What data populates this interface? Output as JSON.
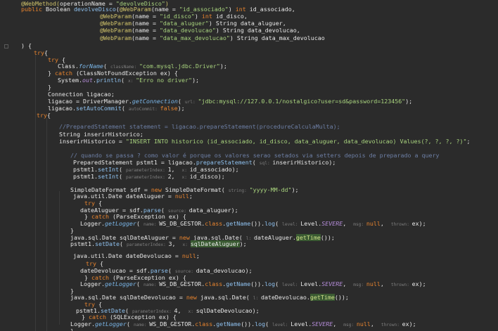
{
  "editor": {
    "lines": [
      {
        "tokens": [
          [
            "ann",
            "@WebMethod("
          ],
          [
            "pl",
            "operationName = "
          ],
          [
            "str",
            "\"devolveDisco\""
          ],
          [
            "ann",
            ")"
          ]
        ]
      },
      {
        "tokens": [
          [
            "kw",
            "public "
          ],
          [
            "pl",
            "Boolean "
          ],
          [
            "met",
            "devolveDisco"
          ],
          [
            "pl",
            "("
          ],
          [
            "ann",
            "@WebParam"
          ],
          [
            "pl",
            "(name = "
          ],
          [
            "str",
            "\"id_associado\""
          ],
          [
            "pl",
            ") "
          ],
          [
            "kw",
            "int "
          ],
          [
            "pl",
            "id_associado,"
          ]
        ]
      },
      {
        "tokens": [
          [
            "ann",
            "@WebParam"
          ],
          [
            "pl",
            "(name = "
          ],
          [
            "str",
            "\"id_disco\""
          ],
          [
            "pl",
            ") "
          ],
          [
            "kw",
            "int "
          ],
          [
            "pl",
            "id_disco,"
          ]
        ]
      },
      {
        "tokens": [
          [
            "ann",
            "@WebParam"
          ],
          [
            "pl",
            "(name = "
          ],
          [
            "str",
            "\"data_aluguer\""
          ],
          [
            "pl",
            ") String data_aluguer,"
          ]
        ]
      },
      {
        "tokens": [
          [
            "ann",
            "@WebParam"
          ],
          [
            "pl",
            "(name = "
          ],
          [
            "str",
            "\"data_devolucao\""
          ],
          [
            "pl",
            ") String data_devolucao,"
          ]
        ]
      },
      {
        "tokens": [
          [
            "ann",
            "@WebParam"
          ],
          [
            "pl",
            "(name = "
          ],
          [
            "str",
            "\"data_max_devolucao\""
          ],
          [
            "pl",
            ") String data_max_devolucao"
          ]
        ]
      },
      {
        "tokens": [
          [
            "pl",
            ") {"
          ]
        ]
      },
      {
        "tokens": [
          [
            "kw",
            "try"
          ],
          [
            "pl",
            "{"
          ]
        ]
      },
      {
        "tokens": [
          [
            "kw",
            "try "
          ],
          [
            "pl",
            "{"
          ]
        ]
      },
      {
        "tokens": [
          [
            "pl",
            "Class."
          ],
          [
            "it",
            "forName"
          ],
          [
            "pl",
            "( "
          ],
          [
            "hint",
            "className: "
          ],
          [
            "str",
            "\"com.mysql.jdbc.Driver\""
          ],
          [
            "pl",
            ");"
          ]
        ]
      },
      {
        "tokens": [
          [
            "pl",
            "} "
          ],
          [
            "kw",
            "catch "
          ],
          [
            "pl",
            "(ClassNotFoundException ex) {"
          ]
        ]
      },
      {
        "tokens": [
          [
            "pl",
            "System."
          ],
          [
            "con",
            "out"
          ],
          [
            "pl",
            "."
          ],
          [
            "met",
            "println"
          ],
          [
            "pl",
            "( "
          ],
          [
            "hint",
            "x: "
          ],
          [
            "str",
            "\"Erro no driver\""
          ],
          [
            "pl",
            ");"
          ]
        ]
      },
      {
        "tokens": [
          [
            "pl",
            "}"
          ]
        ]
      },
      {
        "tokens": [
          [
            "pl",
            "Connection ligacao;"
          ]
        ]
      },
      {
        "tokens": [
          [
            "pl",
            "ligacao = DriverManager."
          ],
          [
            "it",
            "getConnection"
          ],
          [
            "pl",
            "( "
          ],
          [
            "hint",
            "url: "
          ],
          [
            "str",
            "\"jdbc:mysql://127.0.0.1/nostalgico?user=sd&password=123456\""
          ],
          [
            "pl",
            ");"
          ]
        ]
      },
      {
        "tokens": [
          [
            "pl",
            "ligacao."
          ],
          [
            "met",
            "setAutoCommit"
          ],
          [
            "pl",
            "( "
          ],
          [
            "hint",
            "autoCommit: "
          ],
          [
            "kw",
            "false"
          ],
          [
            "pl",
            ");"
          ]
        ]
      },
      {
        "tokens": [
          [
            "kw",
            "try"
          ],
          [
            "pl",
            "{"
          ]
        ]
      },
      {
        "tokens": []
      },
      {
        "tokens": [
          [
            "cmt",
            "//PreparedStatement statement = ligacao.prepareStatement(procedureCalculaMulta);"
          ]
        ]
      },
      {
        "tokens": [
          [
            "pl",
            "String inserirHistorico;"
          ]
        ]
      },
      {
        "tokens": [
          [
            "pl",
            "inserirHistorico = "
          ],
          [
            "str",
            "\"INSERT INTO historico (id_associado, id_disco, data_aluguer, data_devolucao) Values(?, ?, ?, ?)\""
          ],
          [
            "pl",
            ";"
          ]
        ]
      },
      {
        "tokens": []
      },
      {
        "tokens": [
          [
            "cmt",
            "// quando se passa ? como valor é porque os valores serao setados via setters depois de preparado a query"
          ]
        ]
      },
      {
        "tokens": [
          [
            "pl",
            "PreparedStatement pstmt1 = ligacao."
          ],
          [
            "met",
            "prepareStatement"
          ],
          [
            "pl",
            "( "
          ],
          [
            "hint",
            "sql: "
          ],
          [
            "pl",
            "inserirHistorico);"
          ]
        ]
      },
      {
        "tokens": [
          [
            "pl",
            "pstmt1."
          ],
          [
            "met",
            "setInt"
          ],
          [
            "pl",
            "( "
          ],
          [
            "hint",
            "parameterIndex: "
          ],
          [
            "pl",
            "1,  "
          ],
          [
            "hint",
            "x: "
          ],
          [
            "pl",
            "id_associado);"
          ]
        ]
      },
      {
        "tokens": [
          [
            "pl",
            "pstmt1."
          ],
          [
            "met",
            "setInt"
          ],
          [
            "pl",
            "( "
          ],
          [
            "hint",
            "parameterIndex: "
          ],
          [
            "pl",
            "2,  "
          ],
          [
            "hint",
            "x: "
          ],
          [
            "pl",
            "id_disco);"
          ]
        ]
      },
      {
        "tokens": []
      },
      {
        "tokens": [
          [
            "pl",
            "SimpleDateFormat sdf = "
          ],
          [
            "kw",
            "new "
          ],
          [
            "pl",
            "SimpleDateFormat( "
          ],
          [
            "hint",
            "string: "
          ],
          [
            "str",
            "\"yyyy-MM-dd\""
          ],
          [
            "pl",
            ");"
          ]
        ]
      },
      {
        "tokens": [
          [
            "pl",
            "java.util.Date dateAluguer = "
          ],
          [
            "kw",
            "null"
          ],
          [
            "pl",
            ";"
          ]
        ]
      },
      {
        "tokens": [
          [
            "kw",
            "try "
          ],
          [
            "pl",
            "{"
          ]
        ]
      },
      {
        "tokens": [
          [
            "pl",
            "dateAluguer = sdf."
          ],
          [
            "met",
            "parse"
          ],
          [
            "pl",
            "( "
          ],
          [
            "hint",
            "source: "
          ],
          [
            "pl",
            "data_aluguer);"
          ]
        ]
      },
      {
        "tokens": [
          [
            "pl",
            "} "
          ],
          [
            "kw",
            "catch "
          ],
          [
            "pl",
            "(ParseException ex) {"
          ]
        ]
      },
      {
        "tokens": [
          [
            "pl",
            "Logger."
          ],
          [
            "it",
            "getLogger"
          ],
          [
            "pl",
            "( "
          ],
          [
            "hint",
            "name: "
          ],
          [
            "pl",
            "WS_DB_GESTOR."
          ],
          [
            "kw",
            "class"
          ],
          [
            "pl",
            "."
          ],
          [
            "met",
            "getName"
          ],
          [
            "pl",
            "())."
          ],
          [
            "met",
            "log"
          ],
          [
            "pl",
            "( "
          ],
          [
            "hint",
            "level: "
          ],
          [
            "pl",
            "Level."
          ],
          [
            "con",
            "SEVERE"
          ],
          [
            "pl",
            ",  "
          ],
          [
            "hint",
            "msg: "
          ],
          [
            "kw",
            "null"
          ],
          [
            "pl",
            ",  "
          ],
          [
            "hint",
            "thrown: "
          ],
          [
            "pl",
            "ex);"
          ]
        ]
      },
      {
        "tokens": [
          [
            "pl",
            "}"
          ]
        ]
      },
      {
        "tokens": [
          [
            "pl",
            "java.sql.Date sqlDateAluguer = "
          ],
          [
            "kw",
            "new "
          ],
          [
            "pl",
            "java.sql.Date( "
          ],
          [
            "hint",
            "l: "
          ],
          [
            "pl",
            "dateAluguer."
          ],
          [
            "hlm",
            "getTime"
          ],
          [
            "pl",
            "());"
          ]
        ]
      },
      {
        "tokens": [
          [
            "pl",
            "pstmt1."
          ],
          [
            "met",
            "setDate"
          ],
          [
            "pl",
            "( "
          ],
          [
            "hint",
            "parameterIndex: "
          ],
          [
            "pl",
            "3,  "
          ],
          [
            "hint",
            "x: "
          ],
          [
            "hl",
            "sqlDateAluguer"
          ],
          [
            "pl",
            ");"
          ]
        ]
      },
      {
        "tokens": []
      },
      {
        "tokens": [
          [
            "pl",
            "java.util.Date dateDevolucao = "
          ],
          [
            "kw",
            "null"
          ],
          [
            "pl",
            ";"
          ]
        ]
      },
      {
        "tokens": [
          [
            "kw",
            "try "
          ],
          [
            "pl",
            "{"
          ]
        ]
      },
      {
        "tokens": [
          [
            "pl",
            "dateDevolucao = sdf."
          ],
          [
            "met",
            "parse"
          ],
          [
            "pl",
            "( "
          ],
          [
            "hint",
            "source: "
          ],
          [
            "pl",
            "data_devolucao);"
          ]
        ]
      },
      {
        "tokens": [
          [
            "pl",
            "} "
          ],
          [
            "kw",
            "catch "
          ],
          [
            "pl",
            "(ParseException ex) {"
          ]
        ]
      },
      {
        "tokens": [
          [
            "pl",
            "Logger."
          ],
          [
            "it",
            "getLogger"
          ],
          [
            "pl",
            "( "
          ],
          [
            "hint",
            "name: "
          ],
          [
            "pl",
            "WS_DB_GESTOR."
          ],
          [
            "kw",
            "class"
          ],
          [
            "pl",
            "."
          ],
          [
            "met",
            "getName"
          ],
          [
            "pl",
            "())."
          ],
          [
            "met",
            "log"
          ],
          [
            "pl",
            "( "
          ],
          [
            "hint",
            "level: "
          ],
          [
            "pl",
            "Level."
          ],
          [
            "con",
            "SEVERE"
          ],
          [
            "pl",
            ",  "
          ],
          [
            "hint",
            "msg: "
          ],
          [
            "kw",
            "null"
          ],
          [
            "pl",
            ",  "
          ],
          [
            "hint",
            "thrown: "
          ],
          [
            "pl",
            "ex);"
          ]
        ]
      },
      {
        "tokens": [
          [
            "pl",
            "}"
          ]
        ]
      },
      {
        "tokens": [
          [
            "pl",
            "java.sql.Date sqlDateDevolucao = "
          ],
          [
            "kw",
            "new "
          ],
          [
            "pl",
            "java.sql.Date( "
          ],
          [
            "hint",
            "l: "
          ],
          [
            "pl",
            "dateDevolucao."
          ],
          [
            "hlm",
            "getTime"
          ],
          [
            "pl",
            "());"
          ]
        ]
      },
      {
        "tokens": [
          [
            "kw",
            "try "
          ],
          [
            "pl",
            "{"
          ]
        ]
      },
      {
        "tokens": [
          [
            "pl",
            "pstmt1."
          ],
          [
            "met",
            "setDate"
          ],
          [
            "pl",
            "( "
          ],
          [
            "hint",
            "parameterIndex: "
          ],
          [
            "pl",
            "4,  "
          ],
          [
            "hint",
            "x: "
          ],
          [
            "pl",
            "sqlDateDevolucao);"
          ]
        ]
      },
      {
        "tokens": [
          [
            "pl",
            "} "
          ],
          [
            "kw",
            "catch "
          ],
          [
            "pl",
            "(SQLException ex) {"
          ]
        ]
      },
      {
        "tokens": [
          [
            "pl",
            "Logger."
          ],
          [
            "it",
            "getLogger"
          ],
          [
            "pl",
            "( "
          ],
          [
            "hint",
            "name: "
          ],
          [
            "pl",
            "WS_DB_GESTOR."
          ],
          [
            "kw",
            "class"
          ],
          [
            "pl",
            "."
          ],
          [
            "met",
            "getName"
          ],
          [
            "pl",
            "())."
          ],
          [
            "met",
            "log"
          ],
          [
            "pl",
            "( "
          ],
          [
            "hint",
            "level: "
          ],
          [
            "pl",
            "Level."
          ],
          [
            "con",
            "SEVERE"
          ],
          [
            "pl",
            ",  "
          ],
          [
            "hint",
            "msg: "
          ],
          [
            "kw",
            "null"
          ],
          [
            "pl",
            ",  "
          ],
          [
            "hint",
            "thrown: "
          ],
          [
            "pl",
            "ex);"
          ]
        ]
      },
      {
        "tokens": [
          [
            "pl",
            "}"
          ]
        ]
      }
    ]
  }
}
